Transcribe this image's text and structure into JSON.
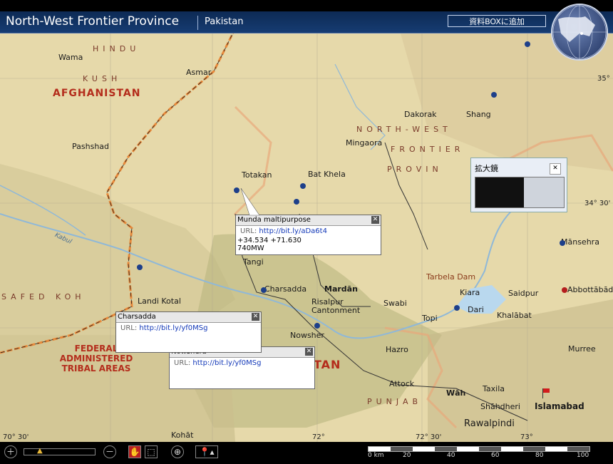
{
  "header": {
    "title": "North-West Frontier Province",
    "country": "Pakistan",
    "add_button": "資料BOXに追加"
  },
  "map": {
    "countries": {
      "afghanistan": "AFGHANISTAN",
      "pakistan_partial": "TAN",
      "tribal": [
        "FEDERAL",
        "ADMINISTERED",
        "TRIBAL AREAS"
      ]
    },
    "regions": {
      "hindu": "HINDU",
      "kush": "KUSH",
      "safed_koh": "SAFED KOH",
      "nwfp_1": "NORTH-WEST",
      "nwfp_2": "FRONTIER",
      "nwfp_3": "PROVIN",
      "punjab": "PUNJAB"
    },
    "places": {
      "wama": "Wama",
      "asmar": "Asmar",
      "pashshad": "Pashshad",
      "dakorak": "Dakorak",
      "shang": "Shang",
      "mingaora": "Mingaora",
      "totakan": "Totakan",
      "bat_khela": "Bat Khela",
      "tangi": "Tangi",
      "landi_kotal": "Landi Kotal",
      "charsadda": "Charsadda",
      "mardan": "Mardān",
      "risalpur": "Risalpur",
      "cantonment": "Cantonment",
      "swabi": "Swabi",
      "topi": "Topi",
      "kiara": "Kiara",
      "dari": "Dari",
      "khalabat": "Khalābat",
      "saidpur": "Saidpur",
      "tarbela": "Tarbela Dam",
      "mansehra": "Mānsehra",
      "abbottabad": "Abbottābād",
      "murree": "Murree",
      "nowshera": "Nowsher",
      "hazro": "Hazro",
      "attock": "Attock",
      "wah": "Wāh",
      "taxila": "Taxila",
      "shahdheri": "Shāhdheri",
      "islamabad": "Islamabad",
      "rawalpindi": "Rawalpindi",
      "kohat": "Kohāt",
      "kabul_river": "Kabul"
    },
    "coords": {
      "c35": "35°",
      "c34_30": "34° 30'",
      "bl_lon": "70° 30'",
      "lon72": "72°",
      "lon72_30": "72° 30'",
      "lon73": "73°"
    }
  },
  "popups": [
    {
      "title": "Munda maltipurpose",
      "url_label": "URL:",
      "url": "http://bit.ly/aDa6t4",
      "line1": "+34.534 +71.630",
      "line2": "740MW"
    },
    {
      "title": "Charsadda",
      "url_label": "URL:",
      "url": "http://bit.ly/yf0MSg"
    },
    {
      "title": "Nowshera",
      "url_label": "URL:",
      "url": "http://bit.ly/yf0MSg"
    }
  ],
  "magnifier": {
    "title": "拡大鏡"
  },
  "scale": {
    "ticks": [
      "0 km",
      "20",
      "40",
      "60",
      "80",
      "100"
    ]
  },
  "colors": {
    "header": "#163c72",
    "border_orange": "#e8893a",
    "river": "#8fb8d8"
  }
}
